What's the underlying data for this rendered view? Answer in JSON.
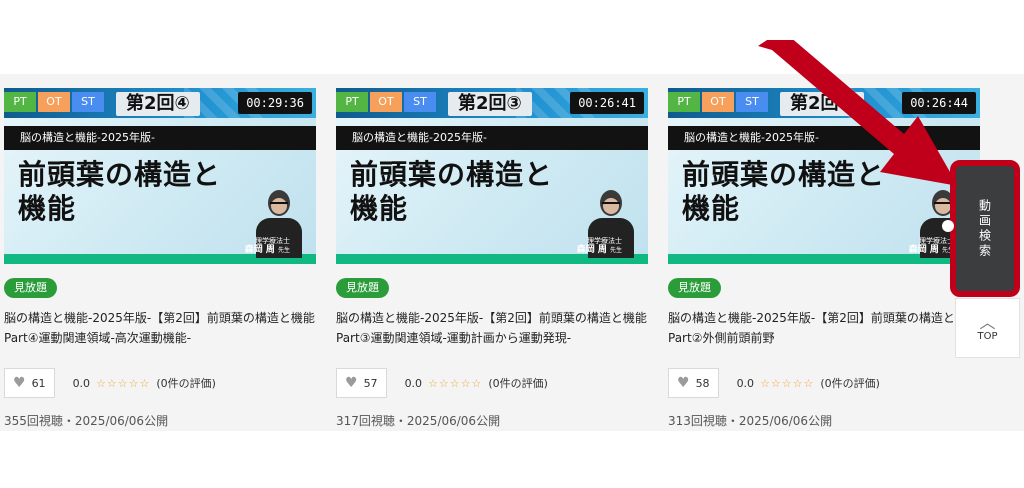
{
  "cards": [
    {
      "tags": [
        "PT",
        "OT",
        "ST"
      ],
      "episode": "第2回④",
      "duration": "00:29:36",
      "series": "脳の構造と機能-2025年版-",
      "headline": "前頭葉の構造と\n機能",
      "credit_role": "理学療法士",
      "credit_name": "森岡 周",
      "credit_suffix": "先生",
      "badge": "見放題",
      "title": "脳の構造と機能-2025年版-【第2回】前頭葉の構造と機能 Part④運動関連領域‐高次運動機能‐",
      "likes": "61",
      "score": "0.0",
      "stars": "☆☆☆☆☆",
      "reviews": "(0件の評価)",
      "views": "355回視聴・2025/06/06公開"
    },
    {
      "tags": [
        "PT",
        "OT",
        "ST"
      ],
      "episode": "第2回③",
      "duration": "00:26:41",
      "series": "脳の構造と機能-2025年版-",
      "headline": "前頭葉の構造と\n機能",
      "credit_role": "理学療法士",
      "credit_name": "森岡 周",
      "credit_suffix": "先生",
      "badge": "見放題",
      "title": "脳の構造と機能-2025年版-【第2回】前頭葉の構造と機能 Part③運動関連領域‐運動計画から運動発現‐",
      "likes": "57",
      "score": "0.0",
      "stars": "☆☆☆☆☆",
      "reviews": "(0件の評価)",
      "views": "317回視聴・2025/06/06公開"
    },
    {
      "tags": [
        "PT",
        "OT",
        "ST"
      ],
      "episode": "第2回②",
      "duration": "00:26:44",
      "series": "脳の構造と機能-2025年版-",
      "headline": "前頭葉の構造と\n機能",
      "credit_role": "理学療法士",
      "credit_name": "森岡 周",
      "credit_suffix": "先生",
      "badge": "見放題",
      "title": "脳の構造と機能-2025年版-【第2回】前頭葉の構造と機能 Part②外側前頭前野",
      "likes": "58",
      "score": "0.0",
      "stars": "☆☆☆☆☆",
      "reviews": "(0件の評価)",
      "views": "313回視聴・2025/06/06公開"
    }
  ],
  "sidebar": {
    "search_label": "動画検索",
    "top_label": "TOP",
    "top_icon": "chevron-up-icon"
  },
  "annotation": {
    "arrow_color": "#c0001a",
    "highlight_color": "#c0001a"
  }
}
